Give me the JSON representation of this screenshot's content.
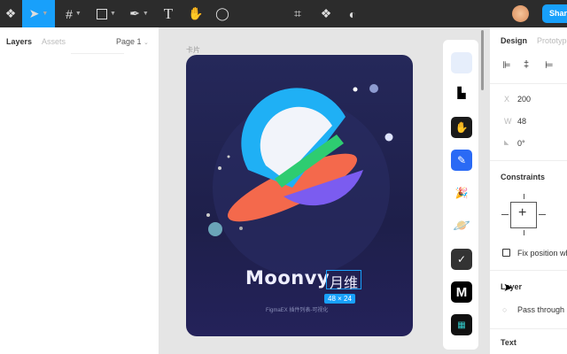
{
  "toolbar": {
    "share_label": "Share"
  },
  "left_panel": {
    "tabs": [
      "Layers",
      "Assets"
    ],
    "page": "Page 1"
  },
  "canvas": {
    "frame_label": "卡片",
    "title": "Moonvy",
    "title_cn": "月维",
    "selection_size": "48 × 24",
    "subtitle": "FigmaEX 插件列表-可视化"
  },
  "right_panel": {
    "tabs": [
      "Design",
      "Prototype"
    ],
    "x_label": "X",
    "x": "200",
    "w_label": "W",
    "w": "48",
    "rotation": "0°",
    "constraints": "Constraints",
    "fix_position": "Fix position wh",
    "layer": "Layer",
    "blend": "Pass through",
    "text": "Text"
  },
  "plugins": [
    "plugin-1",
    "plugin-2",
    "plugin-3",
    "plugin-4",
    "plugin-5",
    "plugin-6",
    "plugin-7",
    "plugin-8",
    "plugin-9"
  ]
}
